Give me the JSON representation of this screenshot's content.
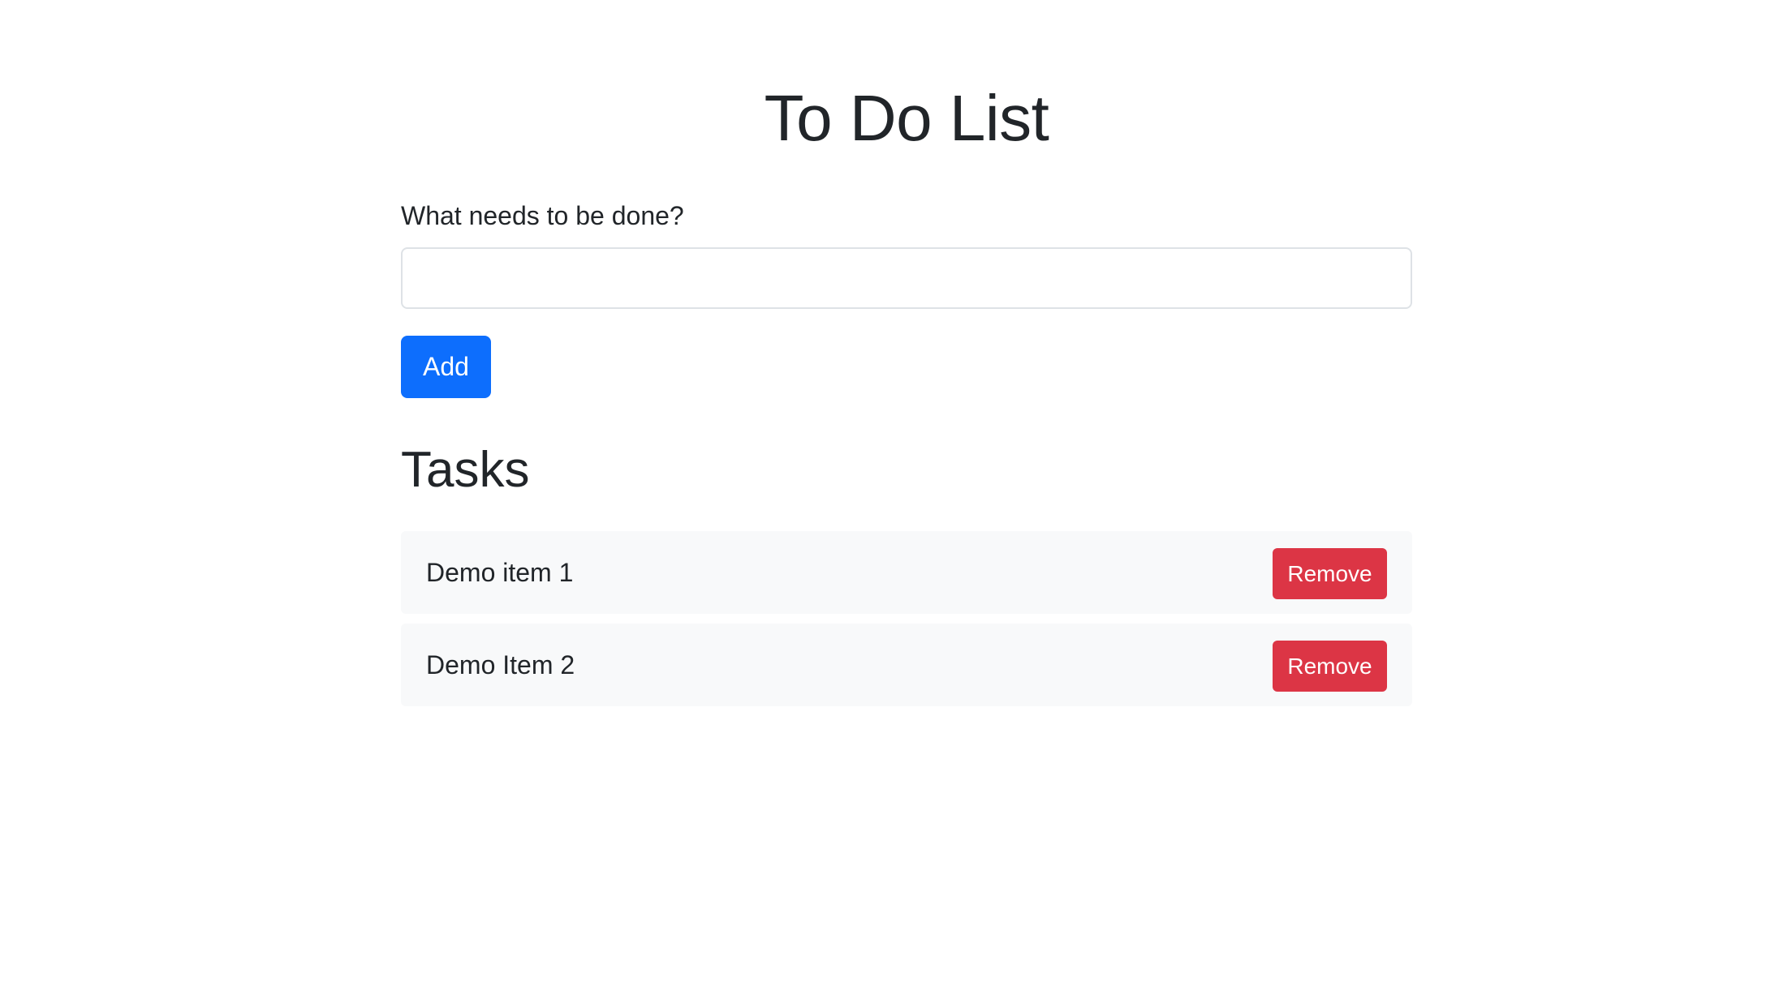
{
  "page": {
    "title": "To Do List"
  },
  "form": {
    "label": "What needs to be done?",
    "input_value": "",
    "input_placeholder": "",
    "add_label": "Add"
  },
  "tasks": {
    "heading": "Tasks",
    "items": [
      {
        "text": "Demo item 1",
        "remove_label": "Remove"
      },
      {
        "text": "Demo Item 2",
        "remove_label": "Remove"
      }
    ]
  },
  "colors": {
    "primary": "#0d6efd",
    "danger": "#dc3545",
    "text": "#212529",
    "item_background": "#f8f9fa"
  }
}
